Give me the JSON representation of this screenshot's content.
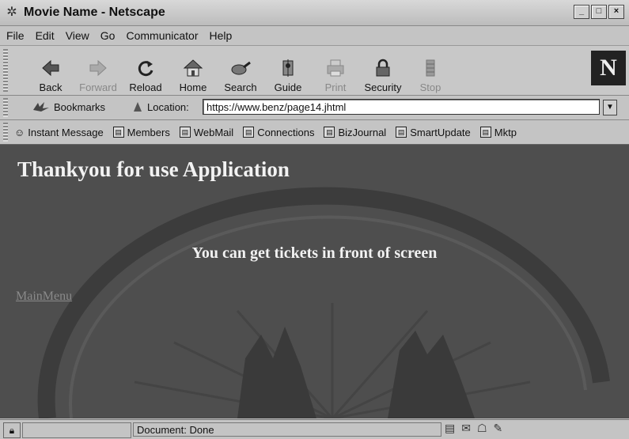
{
  "window": {
    "title": "Movie Name - Netscape",
    "buttons": [
      "_",
      "□",
      "×"
    ]
  },
  "menu": [
    "File",
    "Edit",
    "View",
    "Go",
    "Communicator",
    "Help"
  ],
  "nav": {
    "back": "Back",
    "forward": "Forward",
    "reload": "Reload",
    "home": "Home",
    "search": "Search",
    "guide": "Guide",
    "print": "Print",
    "security": "Security",
    "stop": "Stop",
    "logo": "N"
  },
  "location": {
    "bookmarks_label": "Bookmarks",
    "location_label": "Location:",
    "url": "https://www.benz/page14.jhtml"
  },
  "personal": [
    "Instant Message",
    "Members",
    "WebMail",
    "Connections",
    "BizJournal",
    "SmartUpdate",
    "Mktp"
  ],
  "page": {
    "title": "Thankyou for use Application",
    "message": "You can get tickets in front of screen",
    "link": "MainMenu"
  },
  "status": {
    "text": "Document: Done"
  }
}
